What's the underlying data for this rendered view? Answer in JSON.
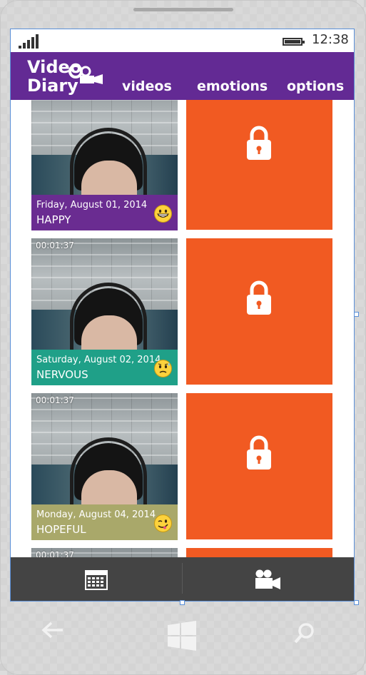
{
  "status_bar": {
    "time": "12:38",
    "signal_icon": "signal-icon",
    "battery_icon": "battery-icon"
  },
  "header": {
    "logo": {
      "line1": "Video",
      "line2": "Diary"
    },
    "nav": [
      {
        "label": "videos"
      },
      {
        "label": "emotions"
      },
      {
        "label": "options"
      }
    ],
    "color": "#632a94"
  },
  "entries": [
    {
      "time": "",
      "date": "Friday, August 01, 2014",
      "emotion": "HAPPY",
      "color": "#6a2c91",
      "emoji": "grinning-emoji-icon",
      "locked": true
    },
    {
      "time": "00:01:37",
      "date": "Saturday, August 02, 2014",
      "emotion": "NERVOUS",
      "color": "#1fa088",
      "emoji": "nervous-emoji-icon",
      "locked": true
    },
    {
      "time": "00:01:37",
      "date": "Monday, August 04, 2014",
      "emotion": "HOPEFUL",
      "color": "#a9a86a",
      "emoji": "wink-emoji-icon",
      "locked": true
    },
    {
      "time": "00:01:37",
      "date": "",
      "emotion": "",
      "color": "#4f585c",
      "emoji": "",
      "locked": true
    }
  ],
  "lock_tile_color": "#f15a22",
  "app_bar": {
    "buttons": [
      {
        "icon": "calendar-icon"
      },
      {
        "icon": "video-camera-icon"
      }
    ],
    "color": "#444444"
  },
  "hardware": {
    "back": "back-arrow-icon",
    "home": "windows-logo-icon",
    "search": "search-icon"
  }
}
